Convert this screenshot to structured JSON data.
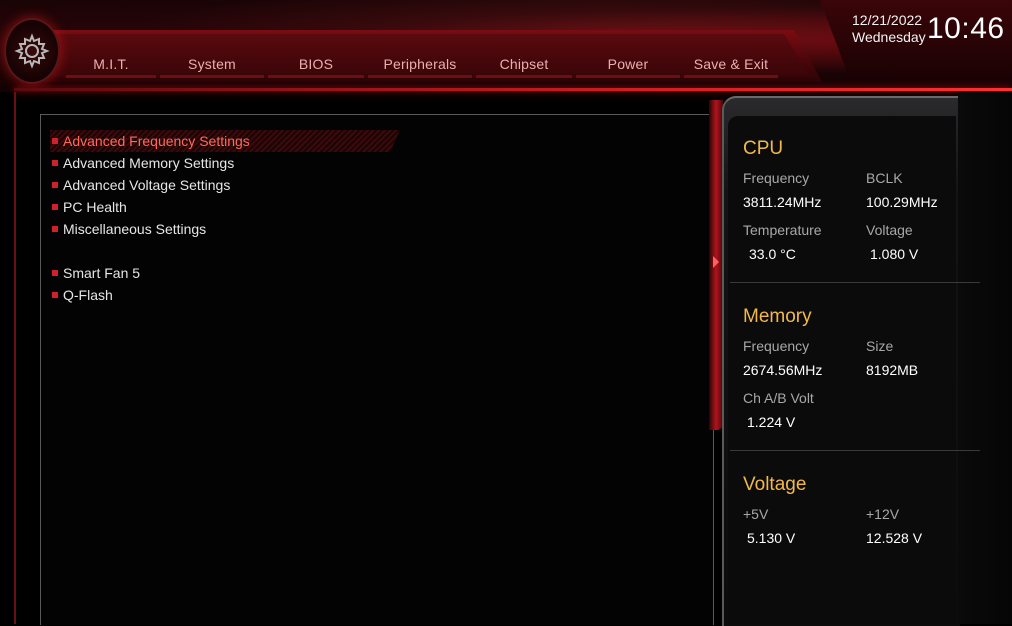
{
  "clock": {
    "date": "12/21/2022",
    "weekday": "Wednesday",
    "time": "10:46"
  },
  "tabs": [
    {
      "label": "M.I.T.",
      "active": true
    },
    {
      "label": "System",
      "active": false
    },
    {
      "label": "BIOS",
      "active": false
    },
    {
      "label": "Peripherals",
      "active": false
    },
    {
      "label": "Chipset",
      "active": false
    },
    {
      "label": "Power",
      "active": false
    },
    {
      "label": "Save & Exit",
      "active": false
    }
  ],
  "menu": {
    "group1": [
      {
        "label": "Advanced Frequency Settings",
        "selected": true
      },
      {
        "label": "Advanced Memory Settings",
        "selected": false
      },
      {
        "label": "Advanced Voltage Settings",
        "selected": false
      },
      {
        "label": "PC Health",
        "selected": false
      },
      {
        "label": "Miscellaneous Settings",
        "selected": false
      }
    ],
    "group2": [
      {
        "label": "Smart Fan 5",
        "selected": false
      },
      {
        "label": "Q-Flash",
        "selected": false
      }
    ]
  },
  "info": {
    "cpu": {
      "title": "CPU",
      "frequency_label": "Frequency",
      "frequency_value": "3811.24MHz",
      "bclk_label": "BCLK",
      "bclk_value": "100.29MHz",
      "temperature_label": "Temperature",
      "temperature_value": "33.0 °C",
      "voltage_label": "Voltage",
      "voltage_value": "1.080 V"
    },
    "memory": {
      "title": "Memory",
      "frequency_label": "Frequency",
      "frequency_value": "2674.56MHz",
      "size_label": "Size",
      "size_value": "8192MB",
      "chab_label": "Ch A/B Volt",
      "chab_value": "1.224 V"
    },
    "voltage": {
      "title": "Voltage",
      "v5_label": "+5V",
      "v5_value": "5.130 V",
      "v12_label": "+12V",
      "v12_value": "12.528 V"
    }
  },
  "colors": {
    "accent_red": "#d0202a",
    "selected_text": "#ff6a5a",
    "section_title": "#f2b84a"
  },
  "icons": {
    "logo": "gear-icon",
    "panel_arrow": "chevron-right-icon"
  }
}
